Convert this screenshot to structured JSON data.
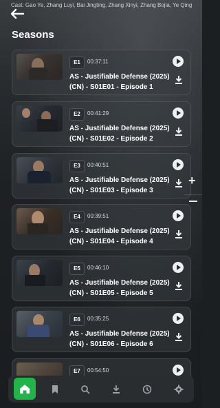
{
  "header": {
    "cast": "Cast: Gao Ye, Zhang Luyi, Bai Jingting, Zhang Xinyi, Zhang Bojia, Ye Qing",
    "section_title": "Seasons"
  },
  "episodes": [
    {
      "badge": "E1",
      "duration": "00:37:11",
      "title": "AS - Justifiable Defense (2025) (CN) - S01E01 - Episode 1"
    },
    {
      "badge": "E2",
      "duration": "00:41:29",
      "title": "AS - Justifiable Defense (2025) (CN) - S01E02 - Episode 2"
    },
    {
      "badge": "E3",
      "duration": "00:40:51",
      "title": "AS - Justifiable Defense (2025) (CN) - S01E03 - Episode 3"
    },
    {
      "badge": "E4",
      "duration": "00:39:51",
      "title": "AS - Justifiable Defense (2025) (CN) - S01E04 - Episode 4"
    },
    {
      "badge": "E5",
      "duration": "00:46:10",
      "title": "AS - Justifiable Defense (2025) (CN) - S01E05 - Episode 5"
    },
    {
      "badge": "E6",
      "duration": "00:35:25",
      "title": "AS - Justifiable Defense (2025) (CN) - S01E06 - Episode 6"
    },
    {
      "badge": "E7",
      "duration": "00:54:50",
      "title": ""
    }
  ],
  "nav": {
    "items": [
      "home-icon",
      "bookmark-icon",
      "search-icon",
      "download-icon",
      "history-icon",
      "settings-icon"
    ],
    "active": "home-icon",
    "accent": "#22b34a"
  },
  "icons": {
    "back": "arrow-left-icon",
    "play": "play-circle-icon",
    "download": "download-icon",
    "zoom_in": "plus-icon",
    "zoom_out": "minus-icon"
  },
  "colors": {
    "accent": "#22b34a",
    "card_bg": "#373c40"
  }
}
